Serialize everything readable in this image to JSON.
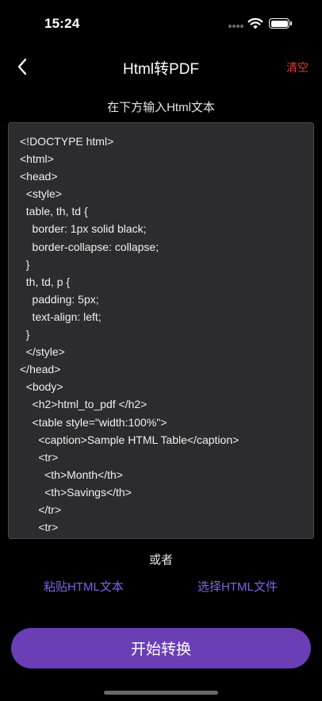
{
  "status_bar": {
    "time": "15:24",
    "icons": [
      "signal-dots-icon",
      "wifi-icon",
      "battery-icon"
    ]
  },
  "nav": {
    "back_icon": "chevron-left-icon",
    "title": "Html转PDF",
    "clear_label": "清空",
    "clear_color": "#e5392b"
  },
  "editor": {
    "hint": "在下方输入Html文本",
    "content": "<!DOCTYPE html>\n<html>\n<head>\n  <style>\n  table, th, td {\n    border: 1px solid black;\n    border-collapse: collapse;\n  }\n  th, td, p {\n    padding: 5px;\n    text-align: left;\n  }\n  </style>\n</head>\n  <body>\n    <h2>html_to_pdf </h2>\n    <table style=\"width:100%\">\n      <caption>Sample HTML Table</caption>\n      <tr>\n        <th>Month</th>\n        <th>Savings</th>\n      </tr>\n      <tr>"
  },
  "actions": {
    "or_label": "或者",
    "paste_label": "粘贴HTML文本",
    "choose_file_label": "选择HTML文件",
    "link_color": "#7d66e6",
    "start_label": "开始转换",
    "start_color": "#6a3fb5"
  }
}
